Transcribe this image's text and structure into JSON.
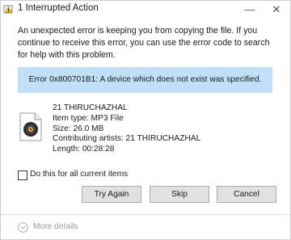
{
  "window": {
    "title": "1 Interrupted Action",
    "minimize_glyph": "—",
    "close_glyph": "✕"
  },
  "message": "An unexpected error is keeping you from copying the file. If you continue to receive this error, you can use the error code to search for help with this problem.",
  "error": {
    "text": "Error 0x800701B1: A device which does not exist was specified.",
    "bar_color": "#bfe0f6"
  },
  "file": {
    "icon": "music-file-icon",
    "name": "21  THIRUCHAZHAL",
    "item_type": "Item type: MP3 File",
    "size": "Size: 26.0 MB",
    "contributing_artists": "Contributing artists: 21  THIRUCHAZHAL",
    "length": "Length: 00:28:28"
  },
  "checkbox": {
    "label": "Do this for all current items",
    "checked": false
  },
  "buttons": {
    "try_again": "Try Again",
    "skip": "Skip",
    "cancel": "Cancel"
  },
  "footer": {
    "more_details": "More details",
    "icon": "chevron-down-circle-icon"
  }
}
